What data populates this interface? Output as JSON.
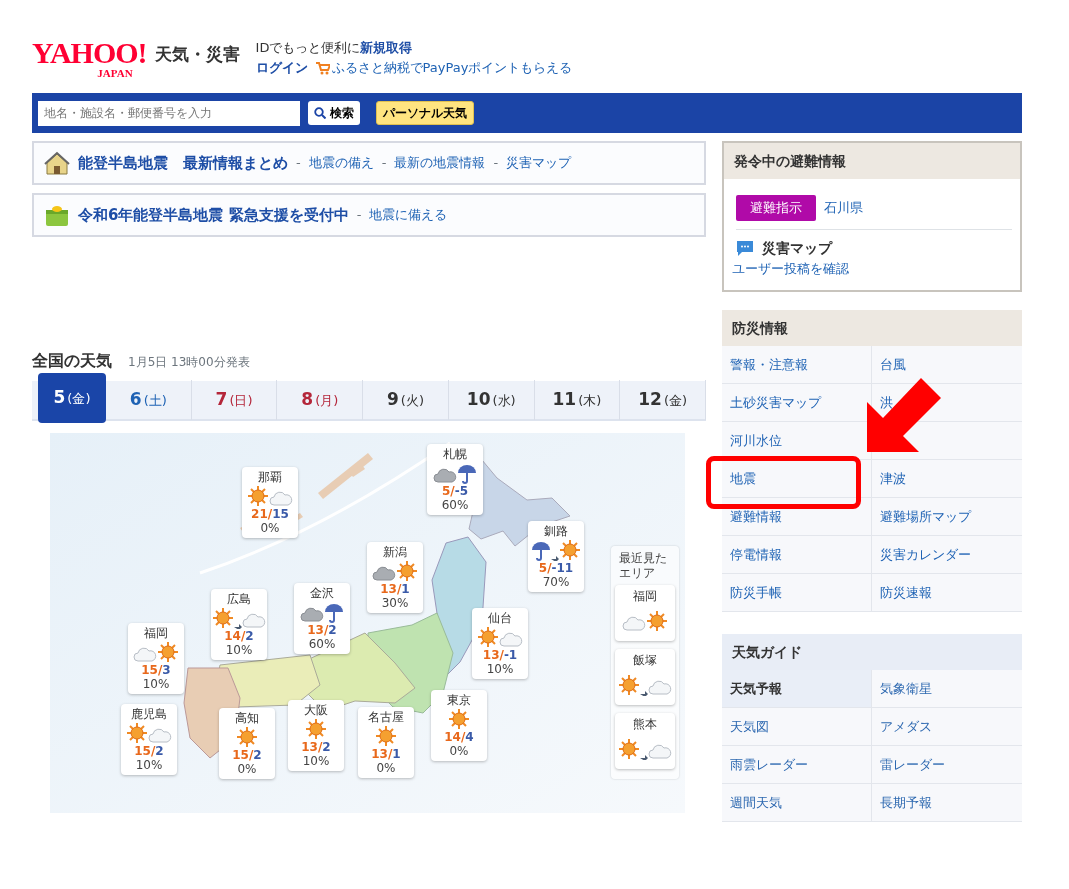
{
  "header": {
    "logo": {
      "main": "YAHOO!",
      "sub": "JAPAN"
    },
    "service": "天気・災害",
    "promo": "IDでもっと便利に",
    "signup": "新規取得",
    "login": "ログイン",
    "furusato": "ふるさと納税でPayPayポイントもらえる"
  },
  "search": {
    "placeholder": "地名・施設名・郵便番号を入力",
    "button": "検索",
    "personal": "パーソナル天気"
  },
  "banners": [
    {
      "title": "能登半島地震　最新情報まとめ",
      "links": [
        {
          "sep": "-",
          "label": "地震の備え"
        },
        {
          "sep": "-",
          "label": "最新の地震情報"
        },
        {
          "sep": "-",
          "label": "災害マップ"
        }
      ]
    },
    {
      "title": "令和6年能登半島地震 緊急支援を受付中",
      "links": [
        {
          "sep": "-",
          "label": "地震に備える"
        }
      ]
    }
  ],
  "weather": {
    "title": "全国の天気",
    "issued": "1月5日 13時00分発表",
    "days": [
      {
        "day": "5",
        "weekday": "(金)",
        "kind": "weekday",
        "selected": true
      },
      {
        "day": "6",
        "weekday": "(土)",
        "kind": "saturday",
        "selected": false
      },
      {
        "day": "7",
        "weekday": "(日)",
        "kind": "holiday",
        "selected": false
      },
      {
        "day": "8",
        "weekday": "(月)",
        "kind": "holiday",
        "selected": false
      },
      {
        "day": "9",
        "weekday": "(火)",
        "kind": "weekday",
        "selected": false
      },
      {
        "day": "10",
        "weekday": "(水)",
        "kind": "weekday",
        "selected": false
      },
      {
        "day": "11",
        "weekday": "(木)",
        "kind": "weekday",
        "selected": false
      },
      {
        "day": "12",
        "weekday": "(金)",
        "kind": "weekday",
        "selected": false
      }
    ],
    "cities": [
      {
        "name": "那覇",
        "icons": [
          {
            "kind": "sun"
          },
          {
            "kind": "cloud"
          }
        ],
        "then": false,
        "temp": "21/15",
        "precip": "0%"
      },
      {
        "name": "札幌",
        "icons": [
          {
            "kind": "heavy_cloud"
          },
          {
            "kind": "rain"
          }
        ],
        "then": false,
        "temp": "5/-5",
        "precip": "60%"
      },
      {
        "name": "釧路",
        "icons": [
          {
            "kind": "rain"
          },
          {
            "kind": "sun"
          }
        ],
        "then": true,
        "temp": "5/-11",
        "precip": "70%"
      },
      {
        "name": "新潟",
        "icons": [
          {
            "kind": "heavy_cloud"
          },
          {
            "kind": "sun"
          }
        ],
        "then": false,
        "temp": "13/1",
        "precip": "30%"
      },
      {
        "name": "広島",
        "icons": [
          {
            "kind": "sun"
          },
          {
            "kind": "cloud"
          }
        ],
        "then": true,
        "temp": "14/2",
        "precip": "10%"
      },
      {
        "name": "金沢",
        "icons": [
          {
            "kind": "heavy_cloud"
          },
          {
            "kind": "rain"
          }
        ],
        "then": false,
        "temp": "13/2",
        "precip": "60%"
      },
      {
        "name": "仙台",
        "icons": [
          {
            "kind": "sun"
          },
          {
            "kind": "cloud"
          }
        ],
        "then": false,
        "temp": "13/-1",
        "precip": "10%"
      },
      {
        "name": "福岡",
        "icons": [
          {
            "kind": "cloud"
          },
          {
            "kind": "sun"
          }
        ],
        "then": false,
        "temp": "15/3",
        "precip": "10%"
      },
      {
        "name": "鹿児島",
        "icons": [
          {
            "kind": "sun"
          },
          {
            "kind": "cloud"
          }
        ],
        "then": false,
        "temp": "15/2",
        "precip": "10%"
      },
      {
        "name": "高知",
        "icons": [
          {
            "kind": "sun"
          }
        ],
        "temp": "15/2",
        "precip": "0%"
      },
      {
        "name": "大阪",
        "icons": [
          {
            "kind": "sun"
          }
        ],
        "temp": "13/2",
        "precip": "10%"
      },
      {
        "name": "名古屋",
        "icons": [
          {
            "kind": "sun"
          }
        ],
        "temp": "13/1",
        "precip": "0%"
      },
      {
        "name": "東京",
        "icons": [
          {
            "kind": "sun"
          }
        ],
        "temp": "14/4",
        "precip": "0%"
      }
    ],
    "recent": {
      "title": "最近見たエリア",
      "areas": [
        {
          "name": "福岡",
          "icons": [
            {
              "kind": "cloud"
            },
            {
              "kind": "sun"
            }
          ],
          "then": false
        },
        {
          "name": "飯塚",
          "icons": [
            {
              "kind": "sun"
            },
            {
              "kind": "cloud"
            }
          ],
          "then": true
        },
        {
          "name": "熊本",
          "icons": [
            {
              "kind": "sun"
            },
            {
              "kind": "cloud"
            }
          ],
          "then": true
        }
      ]
    }
  },
  "evacuation": {
    "title": "発令中の避難情報",
    "level": "避難指示",
    "area": "石川県",
    "map_title": "災害マップ",
    "map_link": "ユーザー投稿を確認"
  },
  "disaster_info": {
    "title": "防災情報",
    "rows": [
      [
        {
          "label": "警報・注意報",
          "highlighted": false
        },
        {
          "label": "台風",
          "highlighted": false
        }
      ],
      [
        {
          "label": "土砂災害マップ",
          "highlighted": false
        },
        {
          "label": "洪",
          "highlighted": false
        }
      ],
      [
        {
          "label": "河川水位",
          "highlighted": false
        }
      ],
      [
        {
          "label": "地震",
          "highlighted": true
        },
        {
          "label": "津波",
          "highlighted": false
        }
      ],
      [
        {
          "label": "避難情報",
          "highlighted": false
        },
        {
          "label": "避難場所マップ",
          "highlighted": false
        }
      ],
      [
        {
          "label": "停電情報",
          "highlighted": false
        },
        {
          "label": "災害カレンダー",
          "highlighted": false
        }
      ],
      [
        {
          "label": "防災手帳",
          "highlighted": false
        },
        {
          "label": "防災速報",
          "highlighted": false
        }
      ]
    ]
  },
  "weather_guide": {
    "title": "天気ガイド",
    "items": [
      {
        "label": "天気予報",
        "selected": true
      },
      {
        "label": "気象衛星",
        "selected": false
      },
      {
        "label": "天気図",
        "selected": false
      },
      {
        "label": "アメダス",
        "selected": false
      },
      {
        "label": "雨雲レーダー",
        "selected": false
      },
      {
        "label": "雷レーダー",
        "selected": false
      },
      {
        "label": "週間天気",
        "selected": false
      },
      {
        "label": "長期予報",
        "selected": false
      }
    ]
  }
}
